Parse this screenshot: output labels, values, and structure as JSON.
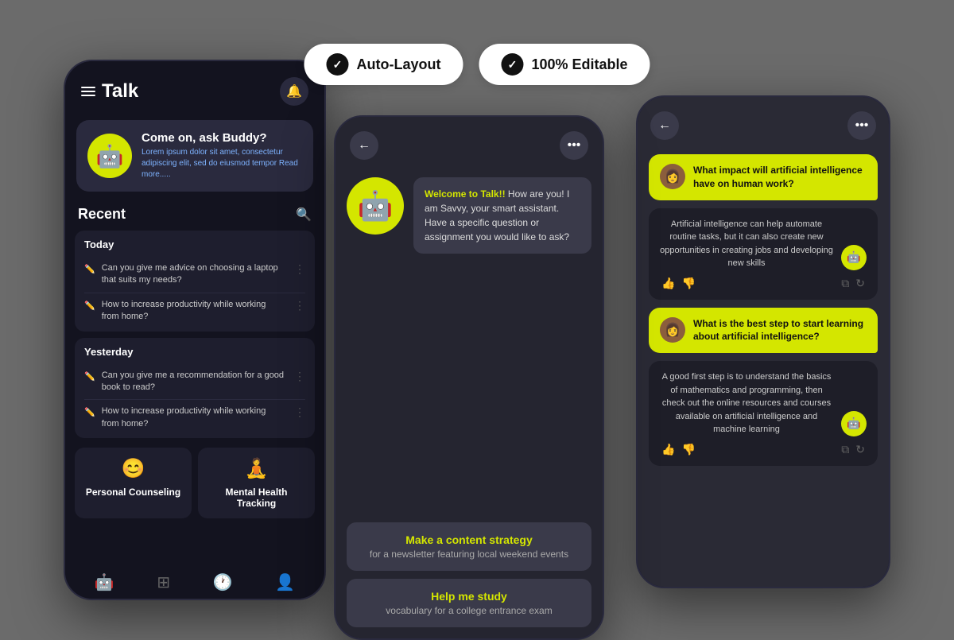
{
  "badges": {
    "auto_layout": "Auto-Layout",
    "editable": "100% Editable"
  },
  "phone1": {
    "title": "Talk",
    "banner": {
      "heading": "Come on, ask Buddy?",
      "body": "Lorem ipsum dolor sit amet, consectetur adipiscing elit, sed do eiusmod tempor",
      "read_more": "Read more....."
    },
    "recent": "Recent",
    "today": "Today",
    "today_items": [
      "Can you give me advice on choosing a laptop that suits my needs?",
      "How to increase productivity while working from home?"
    ],
    "yesterday": "Yesterday",
    "yesterday_items": [
      "Can you give me a recommendation for a good book to read?",
      "How to increase productivity while working from home?"
    ],
    "cards": [
      {
        "icon": "😊",
        "label": "Personal Counseling",
        "sub": ""
      },
      {
        "icon": "🧘",
        "label": "Mental Health Tracking",
        "sub": ""
      }
    ]
  },
  "phone2": {
    "greeting_highlight": "Welcome to Talk!!",
    "greeting_body": " How are you! I am Savvy, your smart assistant. Have a specific question or assignment you would like to ask?",
    "suggestions": [
      {
        "title": "Make a content strategy",
        "sub": "for a newsletter featuring local weekend events"
      },
      {
        "title": "Help me study",
        "sub": "vocabulary for a college entrance exam"
      }
    ]
  },
  "phone3": {
    "messages": [
      {
        "type": "user",
        "text": "What impact will artificial intelligence have on human work?"
      },
      {
        "type": "ai",
        "text": "Artificial intelligence can help automate routine tasks, but it can also create new opportunities in creating jobs and developing new skills"
      },
      {
        "type": "user",
        "text": "What is the best step to start learning about artificial intelligence?"
      },
      {
        "type": "ai",
        "text": "A good first step is to understand the basics of mathematics and programming, then check out the online resources and courses available on artificial intelligence and machine learning"
      }
    ]
  }
}
